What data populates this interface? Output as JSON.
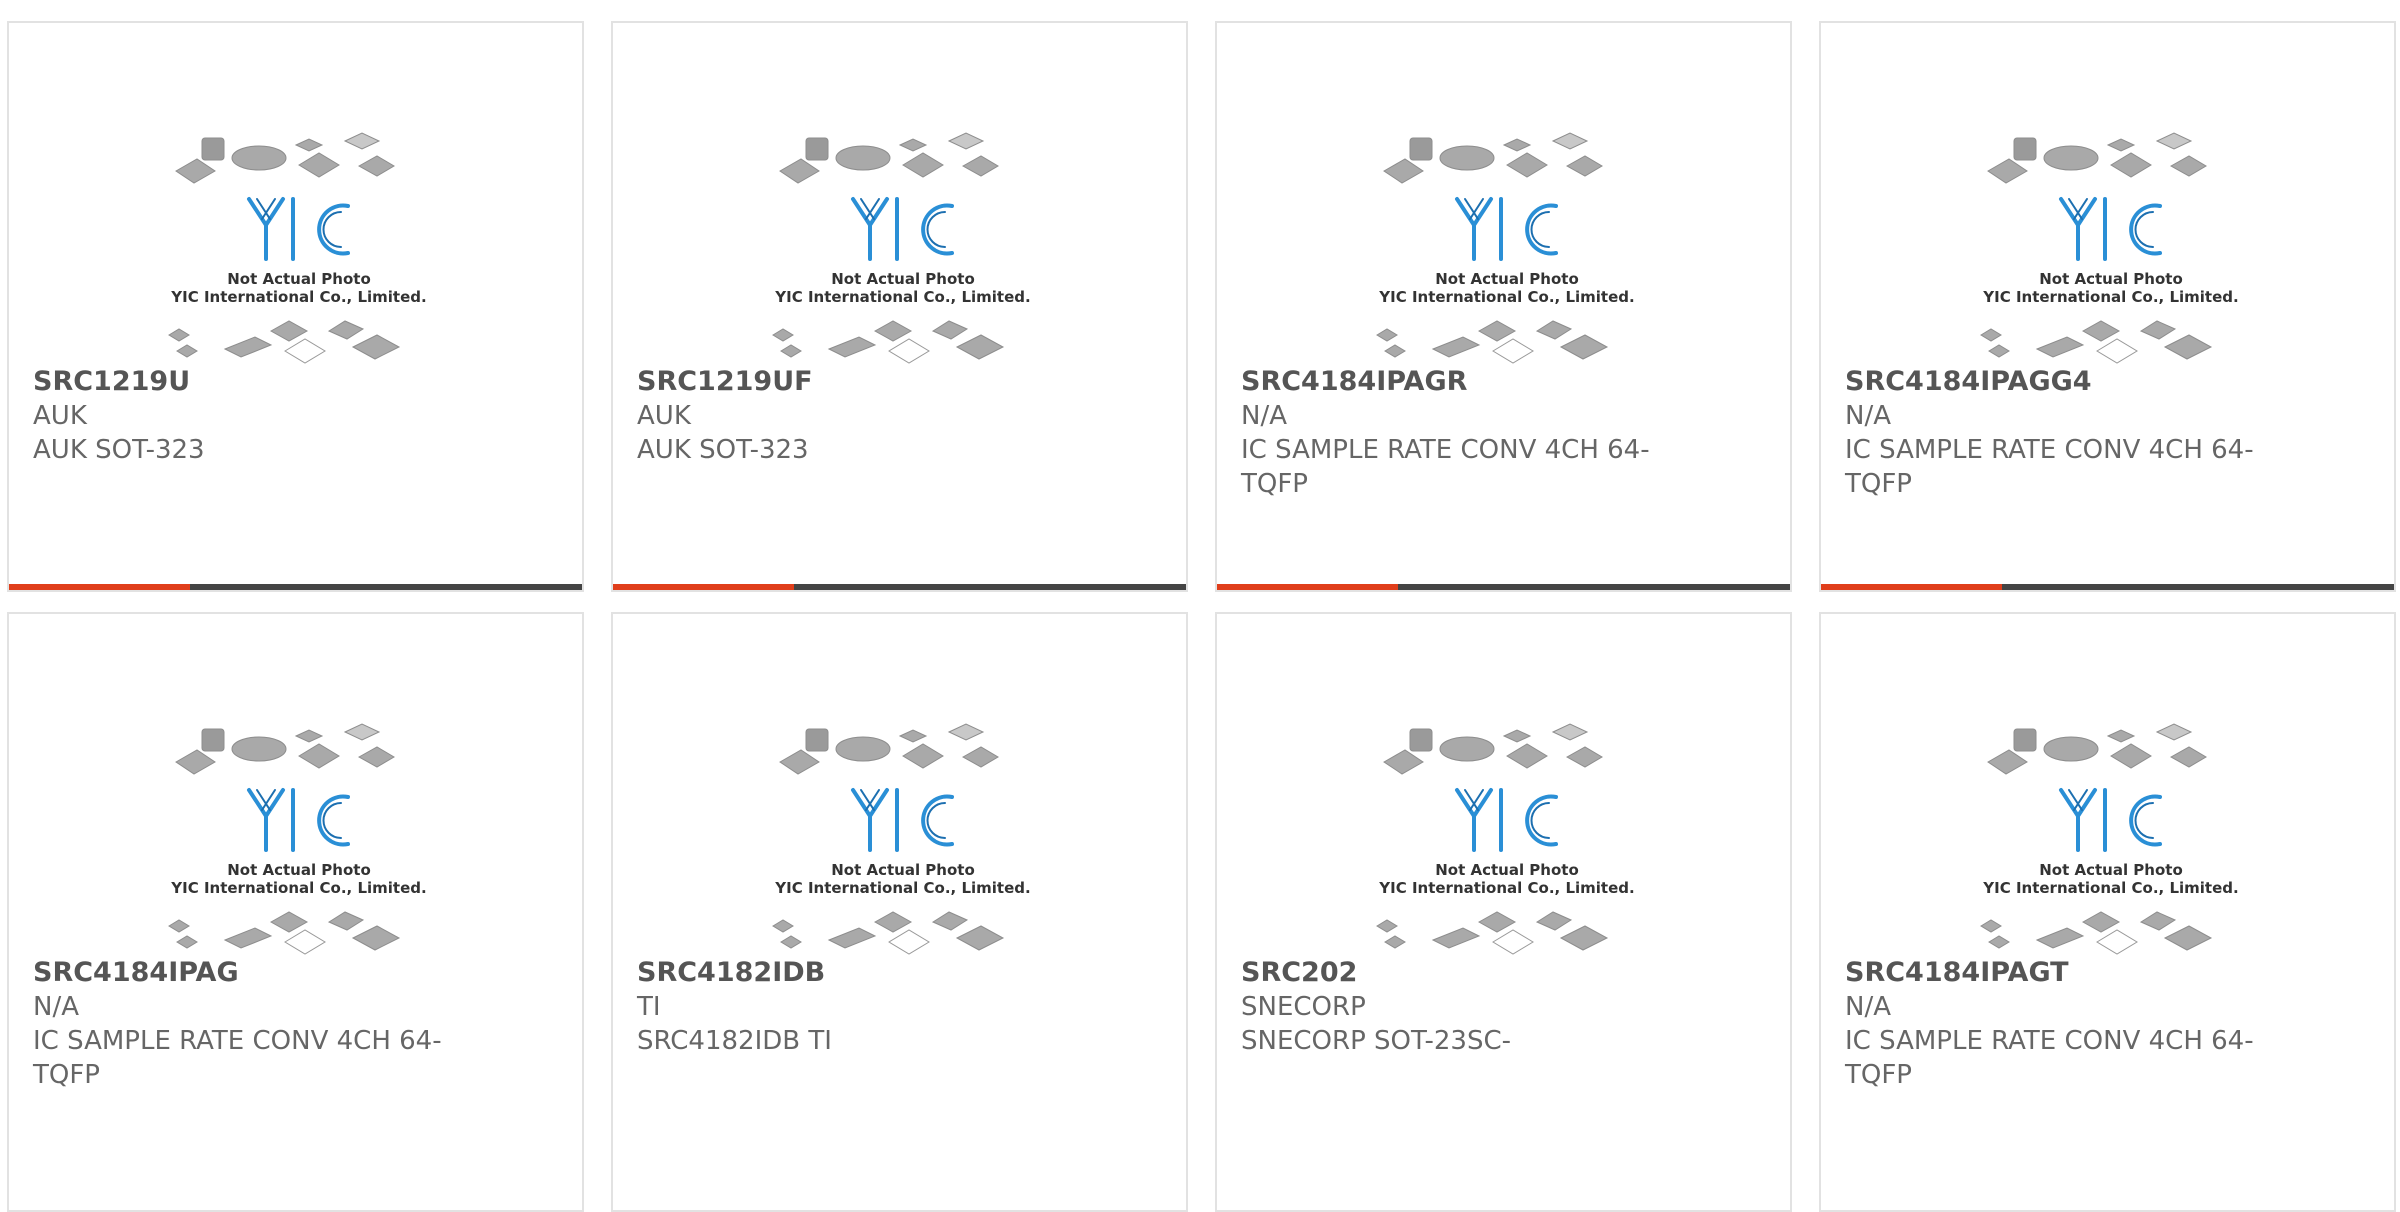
{
  "placeholder": {
    "line1": "Not Actual Photo",
    "line2": "YIC International Co., Limited.",
    "logo": "YIC"
  },
  "colors": {
    "accent": "#e03e1b",
    "bar": "#444444",
    "logo_blue": "#2a8fd6",
    "text": "#666666",
    "title": "#555555"
  },
  "products": [
    {
      "part": "SRC1219U",
      "maker": "AUK",
      "desc": "AUK SOT-323",
      "icon": "chip-placeholder-icon"
    },
    {
      "part": "SRC1219UF",
      "maker": "AUK",
      "desc": "AUK SOT-323",
      "icon": "chip-placeholder-icon"
    },
    {
      "part": "SRC4184IPAGR",
      "maker": "N/A",
      "desc": "IC SAMPLE RATE CONV 4CH 64-TQFP",
      "icon": "chip-placeholder-icon"
    },
    {
      "part": "SRC4184IPAGG4",
      "maker": "N/A",
      "desc": "IC SAMPLE RATE CONV 4CH 64-TQFP",
      "icon": "chip-placeholder-icon"
    },
    {
      "part": "SRC4184IPAG",
      "maker": "N/A",
      "desc": "IC SAMPLE RATE CONV 4CH 64-TQFP",
      "icon": "chip-placeholder-icon"
    },
    {
      "part": "SRC4182IDB",
      "maker": "TI",
      "desc": "SRC4182IDB TI",
      "icon": "chip-placeholder-icon"
    },
    {
      "part": "SRC202",
      "maker": "SNECORP",
      "desc": "SNECORP SOT-23SC-",
      "icon": "chip-placeholder-icon"
    },
    {
      "part": "SRC4184IPAGT",
      "maker": "N/A",
      "desc": "IC SAMPLE RATE CONV 4CH 64-TQFP",
      "icon": "chip-placeholder-icon"
    }
  ]
}
